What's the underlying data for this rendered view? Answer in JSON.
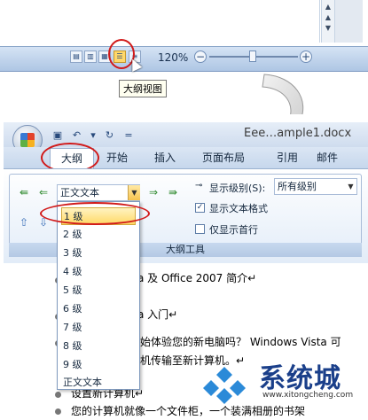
{
  "top": {
    "zoom_percent": "120%",
    "tooltip": "大纲视图",
    "view_buttons": [
      "page-layout",
      "full-screen-reading",
      "web-layout",
      "outline",
      "draft"
    ]
  },
  "window": {
    "title": "Eee…ample1.docx",
    "tabs": [
      "大纲",
      "开始",
      "插入",
      "页面布局",
      "引用",
      "邮件"
    ],
    "active_tab": "大纲"
  },
  "ribbon": {
    "level_combo_value": "正文文本",
    "show_level_label": "显示级别(S):",
    "show_level_value": "所有级别",
    "show_text_format_label": "显示文本格式",
    "show_text_format_checked": true,
    "show_first_line_label": "仅显示首行",
    "show_first_line_checked": false,
    "group_label": "大纲工具"
  },
  "dropdown": {
    "items": [
      "1 级",
      "2 级",
      "3 级",
      "4 级",
      "5 级",
      "6 级",
      "7 级",
      "8 级",
      "9 级",
      "正文文本"
    ],
    "selected_index": 0
  },
  "document": {
    "lines": [
      "sta 及 Office 2007 简介↵",
      "sta 入门↵",
      "始体验您的新电脑吗？ Windows Vista 可",
      "机传输至新计算机。↵",
      "设置新计算机↵",
      "您的计算机就像一个文件柜，一个装满相册的书架"
    ]
  },
  "watermark": {
    "text": "系统城",
    "url": "www.xitongcheng.com"
  }
}
